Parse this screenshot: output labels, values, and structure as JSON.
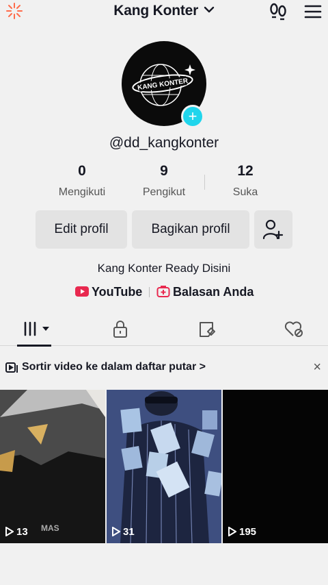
{
  "header": {
    "title": "Kang Konter",
    "left_icon": "sparkle-icon",
    "right_icons": [
      "footprints-icon",
      "hamburger-menu-icon"
    ]
  },
  "profile": {
    "avatar_text": "KANG KONTER",
    "username": "@dd_kangkonter",
    "bio": "Kang Konter Ready Disini"
  },
  "stats": [
    {
      "value": "0",
      "label": "Mengikuti"
    },
    {
      "value": "9",
      "label": "Pengikut"
    },
    {
      "value": "12",
      "label": "Suka"
    }
  ],
  "buttons": {
    "edit": "Edit profil",
    "share": "Bagikan profil",
    "add_friend_icon": "add-user-icon"
  },
  "links": {
    "youtube": "YouTube",
    "replies": "Balasan Anda"
  },
  "tabs": [
    "videos-grid-icon",
    "locked-icon",
    "reposts-icon",
    "liked-icon"
  ],
  "banner": {
    "text": "Sortir video ke dalam daftar putar >",
    "close": "×"
  },
  "videos": [
    {
      "views": "13"
    },
    {
      "views": "31"
    },
    {
      "views": "195"
    }
  ],
  "colors": {
    "accent": "#20d5ec",
    "youtube": "#e8294f",
    "background": "#f1f1f1"
  }
}
